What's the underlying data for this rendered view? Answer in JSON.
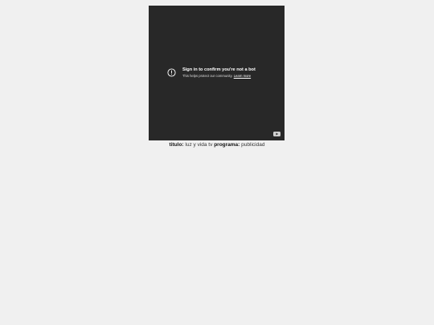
{
  "player": {
    "title": "Sign in to confirm you're not a bot",
    "subtitle": "This helps protect our community.",
    "learn_more": "Learn more",
    "alert_icon": "alert-circle-icon",
    "logo_icon": "youtube-logo-icon"
  },
  "caption": {
    "title_label": "titulo:",
    "title_value": "luz y vida tv",
    "program_label": "programa:",
    "program_value": "publicidad"
  }
}
